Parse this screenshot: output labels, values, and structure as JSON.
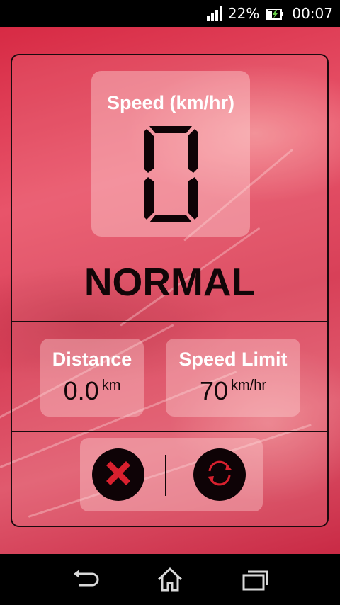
{
  "status_bar": {
    "battery_percent": "22%",
    "time": "00:07",
    "icons": [
      "signal-icon",
      "battery-charging-icon"
    ]
  },
  "speedometer": {
    "speed_label": "Speed (km/hr)",
    "speed_value": "0",
    "status": "NORMAL"
  },
  "distance": {
    "title": "Distance",
    "value": "0.0",
    "unit": "km"
  },
  "speed_limit": {
    "title": "Speed Limit",
    "value": "70",
    "unit": "km/hr"
  },
  "controls": {
    "stop_icon": "close-icon",
    "reset_icon": "refresh-icon"
  },
  "nav_bar": {
    "icons": [
      "back-icon",
      "home-icon",
      "recent-apps-icon"
    ]
  },
  "colors": {
    "accent_red": "#d8202e",
    "dark": "#0e0306"
  }
}
